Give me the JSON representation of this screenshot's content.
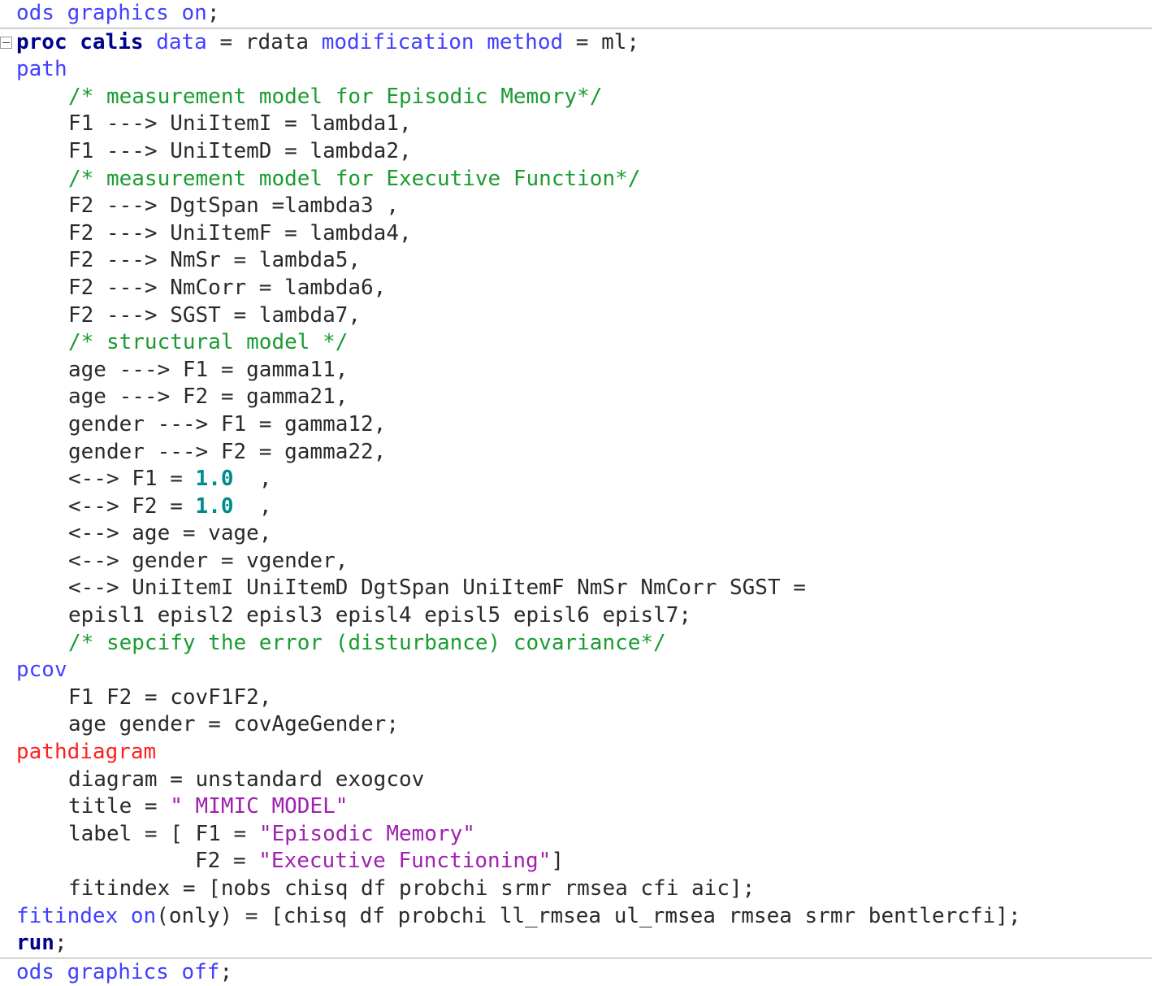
{
  "editor": {
    "app": "SAS Code Editor",
    "language": "SAS",
    "fold_marker_state": "expanded",
    "colors": {
      "background": "#ffffff",
      "proc_keyword": "#00008b",
      "statement_keyword": "#4040ff",
      "pathdiagram_keyword": "#ff2020",
      "plain_text": "#2a2a2a",
      "comment": "#1a9c30",
      "string": "#a020b0",
      "number": "#008b8b",
      "rule": "#b8b8b8"
    }
  },
  "code": {
    "l01_ods_on": "ods graphics on",
    "l01_semi": ";",
    "l02_proc": "proc calis",
    "l02_data": " data",
    "l02_eq_rdata": " = rdata ",
    "l02_modification": "modification",
    "l02_sp": " ",
    "l02_method": "method",
    "l02_eq_ml": " = ml;",
    "l03_path": "path",
    "l04_comment": "/* measurement model for Episodic Memory*/",
    "l05": "F1 ---> UniItemI = lambda1,",
    "l06": "F1 ---> UniItemD = lambda2,",
    "l07_comment": "/* measurement model for Executive Function*/",
    "l08": "F2 ---> DgtSpan =lambda3 ,",
    "l09": "F2 ---> UniItemF = lambda4,",
    "l10": "F2 ---> NmSr = lambda5,",
    "l11": "F2 ---> NmCorr = lambda6,",
    "l12": "F2 ---> SGST = lambda7,",
    "l13_comment": "/* structural model */",
    "l14": "age ---> F1 = gamma11,",
    "l15": "age ---> F2 = gamma21,",
    "l16": "gender ---> F1 = gamma12,",
    "l17": "gender ---> F2 = gamma22,",
    "l18_pre": "<--> F1 = ",
    "l18_num": "1.0",
    "l18_post": "  ,",
    "l19_pre": "<--> F2 = ",
    "l19_num": "1.0",
    "l19_post": "  ,",
    "l20": "<--> age = vage,",
    "l21": "<--> gender = vgender,",
    "l22": "<--> UniItemI UniItemD DgtSpan UniItemF NmSr NmCorr SGST =",
    "l23": "episl1 episl2 episl3 episl4 episl5 episl6 episl7;",
    "l24_comment": "/* sepcify the error (disturbance) covariance*/",
    "l25_pcov": "pcov",
    "l26": "F1 F2 = covF1F2,",
    "l27": "age gender = covAgeGender;",
    "l28_pathdiagram": "pathdiagram",
    "l29": "diagram = unstandard exogcov",
    "l30_pre": "title = ",
    "l30_str": "\" MIMIC MODEL\"",
    "l31_pre": "label = [ F1 = ",
    "l31_str": "\"Episodic Memory\"",
    "l32_pre": "F2 = ",
    "l32_str": "\"Executive Functioning\"",
    "l32_post": "]",
    "l33": "fitindex = [nobs chisq df probchi srmr rmsea cfi aic];",
    "l34_fitindex": "fitindex",
    "l34_sp": " ",
    "l34_on": "on",
    "l34_rest": "(only) = [chisq df probchi ll_rmsea ul_rmsea rmsea srmr bentlercfi];",
    "l35_run": "run",
    "l35_semi": ";",
    "l36_ods_off": "ods graphics off",
    "l36_semi": ";"
  }
}
